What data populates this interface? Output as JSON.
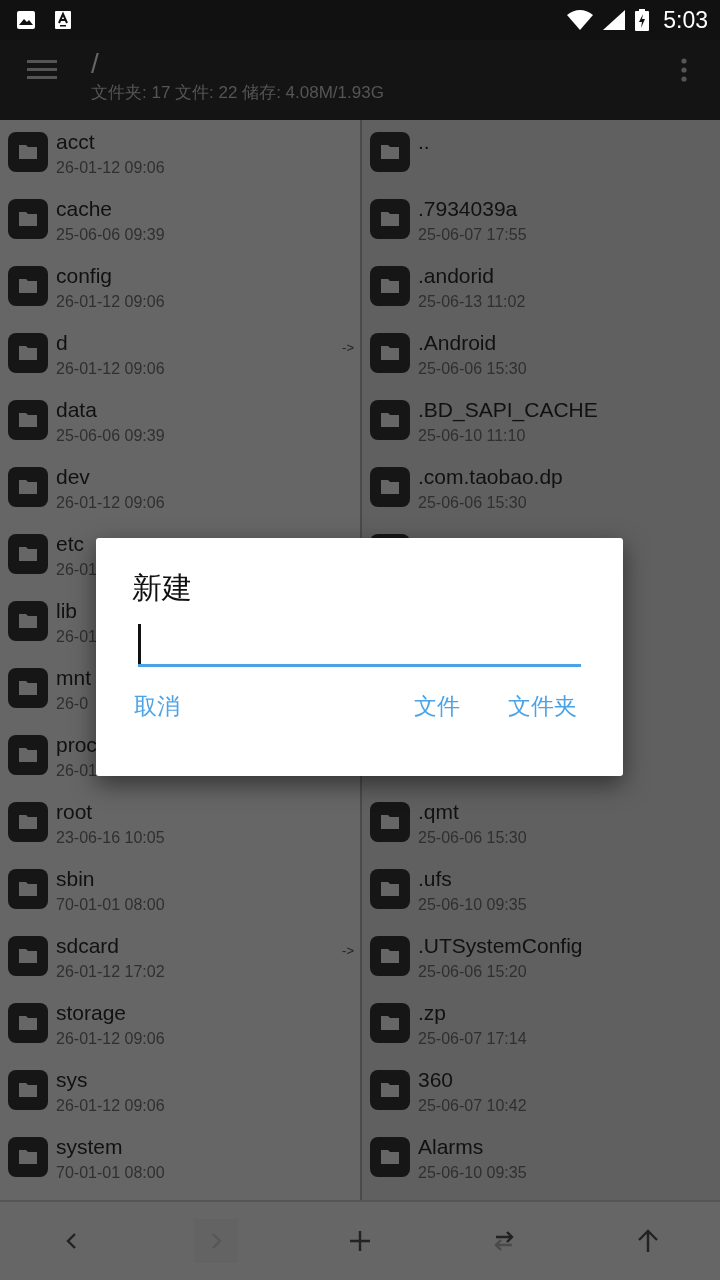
{
  "status_bar": {
    "time": "5:03"
  },
  "header": {
    "title": "/",
    "summary": "文件夹: 17  文件: 22  储存: 4.08M/1.93G"
  },
  "left_pane": [
    {
      "name": "acct",
      "date": "26-01-12 09:06"
    },
    {
      "name": "cache",
      "date": "25-06-06 09:39"
    },
    {
      "name": "config",
      "date": "26-01-12 09:06"
    },
    {
      "name": "d",
      "date": "26-01-12 09:06",
      "link": "->"
    },
    {
      "name": "data",
      "date": "25-06-06 09:39"
    },
    {
      "name": "dev",
      "date": "26-01-12 09:06"
    },
    {
      "name": "etc",
      "date": "26-01"
    },
    {
      "name": "lib",
      "date": "26-01"
    },
    {
      "name": "mnt",
      "date": "26-0"
    },
    {
      "name": "proc",
      "date": "26-01"
    },
    {
      "name": "root",
      "date": "23-06-16 10:05"
    },
    {
      "name": "sbin",
      "date": "70-01-01 08:00"
    },
    {
      "name": "sdcard",
      "date": "26-01-12 17:02",
      "link": "->"
    },
    {
      "name": "storage",
      "date": "26-01-12 09:06"
    },
    {
      "name": "sys",
      "date": "26-01-12 09:06"
    },
    {
      "name": "system",
      "date": "70-01-01 08:00"
    }
  ],
  "right_pane": [
    {
      "name": ".."
    },
    {
      "name": ".7934039a",
      "date": "25-06-07 17:55"
    },
    {
      "name": ".andorid",
      "date": "25-06-13 11:02"
    },
    {
      "name": ".Android",
      "date": "25-06-06 15:30"
    },
    {
      "name": ".BD_SAPI_CACHE",
      "date": "25-06-10 11:10"
    },
    {
      "name": ".com.taobao.dp",
      "date": "25-06-06 15:30"
    }
  ],
  "right_pane_below_dialog": [
    {
      "name": ".qmt",
      "date": "25-06-06 15:30"
    },
    {
      "name": ".ufs",
      "date": "25-06-10 09:35"
    },
    {
      "name": ".UTSystemConfig",
      "date": "25-06-06 15:20"
    },
    {
      "name": ".zp",
      "date": "25-06-07 17:14"
    },
    {
      "name": "360",
      "date": "25-06-07 10:42"
    },
    {
      "name": "Alarms",
      "date": "25-06-10 09:35"
    }
  ],
  "toolbar": [
    {
      "kind": "back",
      "disabled": false
    },
    {
      "kind": "forward",
      "disabled": true
    },
    {
      "kind": "add",
      "disabled": false
    },
    {
      "kind": "swap",
      "disabled": false
    },
    {
      "kind": "up",
      "disabled": false
    }
  ],
  "dialog": {
    "title": "新建",
    "buttons": [
      "取消",
      "文件",
      "文件夹"
    ]
  }
}
